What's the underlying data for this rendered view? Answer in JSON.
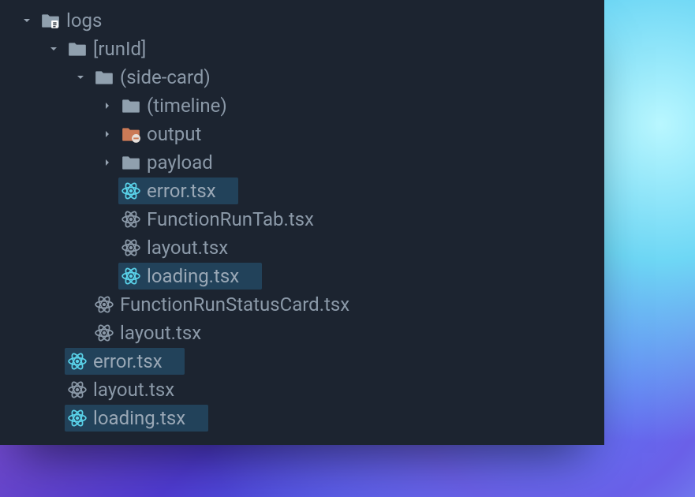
{
  "tree": {
    "root": {
      "label": "logs",
      "expanded": true,
      "children": {
        "runId": {
          "label": "[runId]",
          "expanded": true,
          "children": {
            "sideCard": {
              "label": "(side-card)",
              "expanded": true,
              "children": {
                "timeline": {
                  "label": "(timeline)",
                  "expanded": false
                },
                "output": {
                  "label": "output",
                  "expanded": false,
                  "variant": "orange-minus"
                },
                "payload": {
                  "label": "payload",
                  "expanded": false
                },
                "error": {
                  "label": "error.tsx",
                  "highlight": true
                },
                "fnTab": {
                  "label": "FunctionRunTab.tsx",
                  "highlight": false
                },
                "layout": {
                  "label": "layout.tsx",
                  "highlight": false
                },
                "loading": {
                  "label": "loading.tsx",
                  "highlight": true
                }
              }
            },
            "statusCard": {
              "label": "FunctionRunStatusCard.tsx",
              "highlight": false
            },
            "layout": {
              "label": "layout.tsx",
              "highlight": false
            }
          }
        },
        "error": {
          "label": "error.tsx",
          "highlight": true
        },
        "layout": {
          "label": "layout.tsx",
          "highlight": false
        },
        "loading": {
          "label": "loading.tsx",
          "highlight": true
        }
      }
    }
  },
  "colors": {
    "panel_bg": "#1c2430",
    "text": "#8b99a8",
    "highlight_bg": "#22425a",
    "react_icon": "#5ad3ea",
    "folder_icon": "#90a0ae",
    "folder_orange": "#cb7a56"
  }
}
